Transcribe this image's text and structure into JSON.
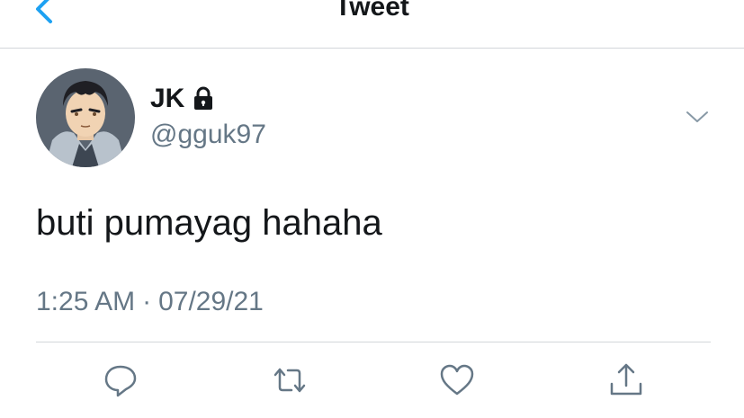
{
  "header": {
    "title": "Tweet",
    "back_icon": "chevron-left-icon",
    "accent_color": "#1da1f2"
  },
  "author": {
    "display_name": "JK",
    "handle": "@gguk97",
    "protected_icon": "lock-icon",
    "more_icon": "chevron-down-icon"
  },
  "tweet": {
    "text": "buti pumayag hahaha",
    "time": "1:25 AM",
    "separator": "·",
    "date": "07/29/21"
  },
  "actions": [
    {
      "name": "reply",
      "icon": "reply-icon"
    },
    {
      "name": "retweet",
      "icon": "retweet-icon"
    },
    {
      "name": "like",
      "icon": "heart-icon"
    },
    {
      "name": "share",
      "icon": "share-icon"
    }
  ],
  "colors": {
    "text_primary": "#14171a",
    "text_secondary": "#657786",
    "divider": "#d3d6da",
    "icon": "#657786"
  }
}
